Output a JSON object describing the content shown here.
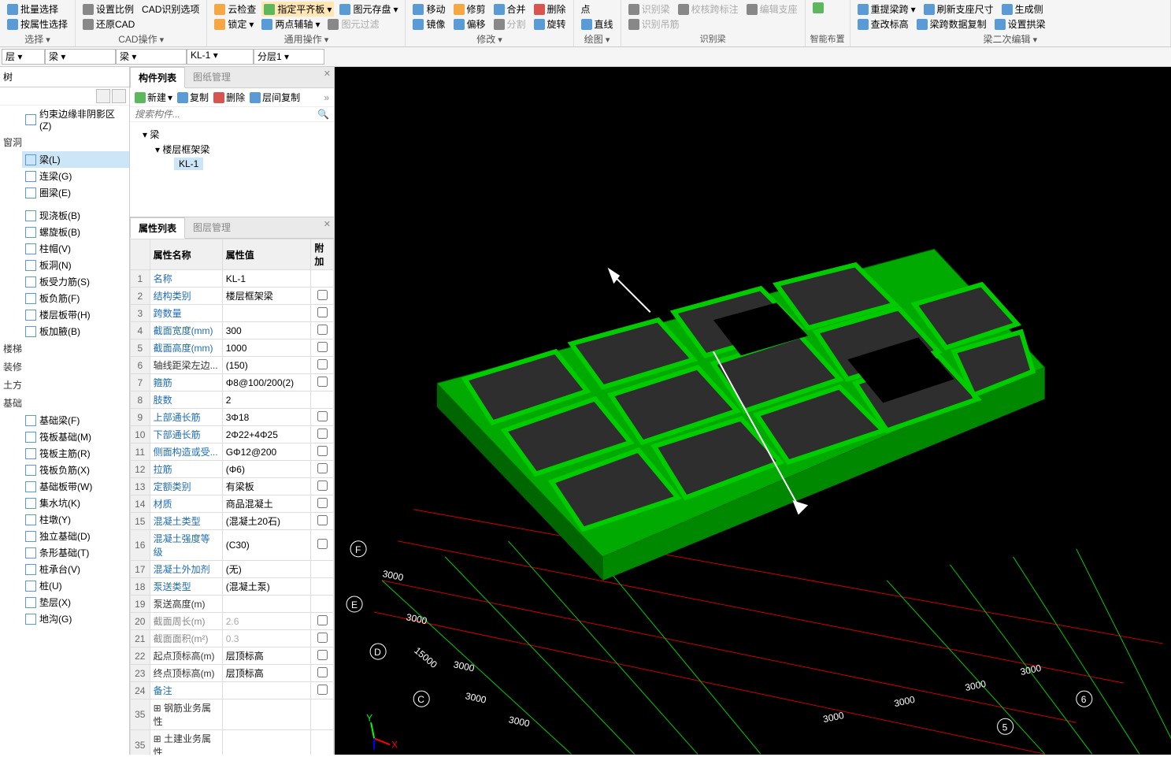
{
  "ribbon": {
    "g1": {
      "items": [
        "批量选择",
        "按属性选择"
      ],
      "label": "选择"
    },
    "g2": {
      "items": [
        "设置比例",
        "还原CAD",
        "CAD识别选项"
      ],
      "label": "CAD操作"
    },
    "g3": {
      "items": [
        "云检查",
        "锁定",
        "指定平齐板",
        "两点辅轴",
        "图元存盘",
        "图元过滤"
      ],
      "label": "通用操作"
    },
    "g4": {
      "items": [
        "移动",
        "镜像",
        "修剪",
        "偏移",
        "合并",
        "分割",
        "删除",
        "旋转"
      ],
      "label": "修改"
    },
    "g5": {
      "items": [
        "点",
        "直线"
      ],
      "label": "绘图"
    },
    "g6": {
      "items": [
        "识别梁",
        "校核跨标注",
        "识别吊筋",
        "编辑支座"
      ],
      "label": "识别梁"
    },
    "g7": {
      "items": [
        "智能布置"
      ],
      "label": ""
    },
    "g8": {
      "items": [
        "重提梁跨",
        "查改标高",
        "梁跨数据复制",
        "刷新支座尺寸",
        "设置拱梁",
        "生成侧"
      ],
      "label": "梁二次编辑"
    }
  },
  "dropdowns": {
    "layer": "层",
    "type1": "梁",
    "type2": "梁",
    "code": "KL-1",
    "floor": "分层1"
  },
  "leftTree": {
    "title": "树",
    "topItem": "约束边缘非阴影区(Z)",
    "cat1": "窗洞",
    "beamGroup": [
      "梁(L)",
      "连梁(G)",
      "圈梁(E)"
    ],
    "slab": [
      "现浇板(B)",
      "螺旋板(B)",
      "柱帽(V)",
      "板洞(N)",
      "板受力筋(S)",
      "板负筋(F)",
      "楼层板带(H)",
      "板加腋(B)"
    ],
    "cats": [
      "楼梯",
      "装修",
      "土方",
      "基础"
    ],
    "found": [
      "基础梁(F)",
      "筏板基础(M)",
      "筏板主筋(R)",
      "筏板负筋(X)",
      "基础板带(W)",
      "集水坑(K)",
      "柱墩(Y)",
      "独立基础(D)",
      "条形基础(T)",
      "桩承台(V)",
      "桩(U)",
      "垫层(X)",
      "地沟(G)"
    ]
  },
  "compPanel": {
    "tabs": [
      "构件列表",
      "图纸管理"
    ],
    "toolbar": [
      "新建",
      "复制",
      "删除",
      "层间复制"
    ],
    "search": "搜索构件...",
    "root": "梁",
    "sub": "楼层框架梁",
    "leaf": "KL-1"
  },
  "propPanel": {
    "tabs": [
      "属性列表",
      "图层管理"
    ],
    "headers": [
      "",
      "属性名称",
      "属性值",
      "附加"
    ],
    "rows": [
      {
        "i": 1,
        "n": "名称",
        "v": "KL-1",
        "chk": null,
        "link": true
      },
      {
        "i": 2,
        "n": "结构类别",
        "v": "楼层框架梁",
        "chk": false,
        "link": true
      },
      {
        "i": 3,
        "n": "跨数量",
        "v": "",
        "chk": false,
        "link": true
      },
      {
        "i": 4,
        "n": "截面宽度(mm)",
        "v": "300",
        "chk": false,
        "link": true
      },
      {
        "i": 5,
        "n": "截面高度(mm)",
        "v": "1000",
        "chk": false,
        "link": true
      },
      {
        "i": 6,
        "n": "轴线距梁左边...",
        "v": "(150)",
        "chk": false,
        "link": false
      },
      {
        "i": 7,
        "n": "箍筋",
        "v": "Φ8@100/200(2)",
        "chk": false,
        "link": true
      },
      {
        "i": 8,
        "n": "肢数",
        "v": "2",
        "chk": null,
        "link": true
      },
      {
        "i": 9,
        "n": "上部通长筋",
        "v": "3Φ18",
        "chk": false,
        "link": true
      },
      {
        "i": 10,
        "n": "下部通长筋",
        "v": "2Φ22+4Φ25",
        "chk": false,
        "link": true
      },
      {
        "i": 11,
        "n": "侧面构造或受...",
        "v": "GΦ12@200",
        "chk": false,
        "link": true
      },
      {
        "i": 12,
        "n": "拉筋",
        "v": "(Φ6)",
        "chk": false,
        "link": true
      },
      {
        "i": 13,
        "n": "定额类别",
        "v": "有梁板",
        "chk": false,
        "link": true
      },
      {
        "i": 14,
        "n": "材质",
        "v": "商品混凝土",
        "chk": false,
        "link": true
      },
      {
        "i": 15,
        "n": "混凝土类型",
        "v": "(混凝土20石)",
        "chk": false,
        "link": true
      },
      {
        "i": 16,
        "n": "混凝土强度等级",
        "v": "(C30)",
        "chk": false,
        "link": true
      },
      {
        "i": 17,
        "n": "混凝土外加剂",
        "v": "(无)",
        "chk": null,
        "link": true
      },
      {
        "i": 18,
        "n": "泵送类型",
        "v": "(混凝土泵)",
        "chk": null,
        "link": true
      },
      {
        "i": 19,
        "n": "泵送高度(m)",
        "v": "",
        "chk": null,
        "link": false
      },
      {
        "i": 20,
        "n": "截面周长(m)",
        "v": "2.6",
        "chk": false,
        "link": true,
        "dim": true
      },
      {
        "i": 21,
        "n": "截面面积(m²)",
        "v": "0.3",
        "chk": false,
        "link": true,
        "dim": true
      },
      {
        "i": 22,
        "n": "起点顶标高(m)",
        "v": "层顶标高",
        "chk": false,
        "link": false
      },
      {
        "i": 23,
        "n": "终点顶标高(m)",
        "v": "层顶标高",
        "chk": false,
        "link": false
      },
      {
        "i": 24,
        "n": "备注",
        "v": "",
        "chk": false,
        "link": true
      },
      {
        "i": 35,
        "n": "⊞ 钢筋业务属性",
        "v": "",
        "chk": null,
        "link": false
      },
      {
        "i": 35,
        "n": "⊞ 土建业务属性",
        "v": "",
        "chk": null,
        "link": false,
        "alt": true
      }
    ]
  },
  "axis": {
    "labels": [
      "F",
      "E",
      "D",
      "C"
    ],
    "dims": [
      "3000",
      "3000",
      "3000",
      "3000",
      "3000",
      "3000",
      "3000",
      "3000",
      "15000",
      "3000",
      "3000",
      "3000"
    ],
    "nums": [
      "5",
      "6"
    ]
  }
}
